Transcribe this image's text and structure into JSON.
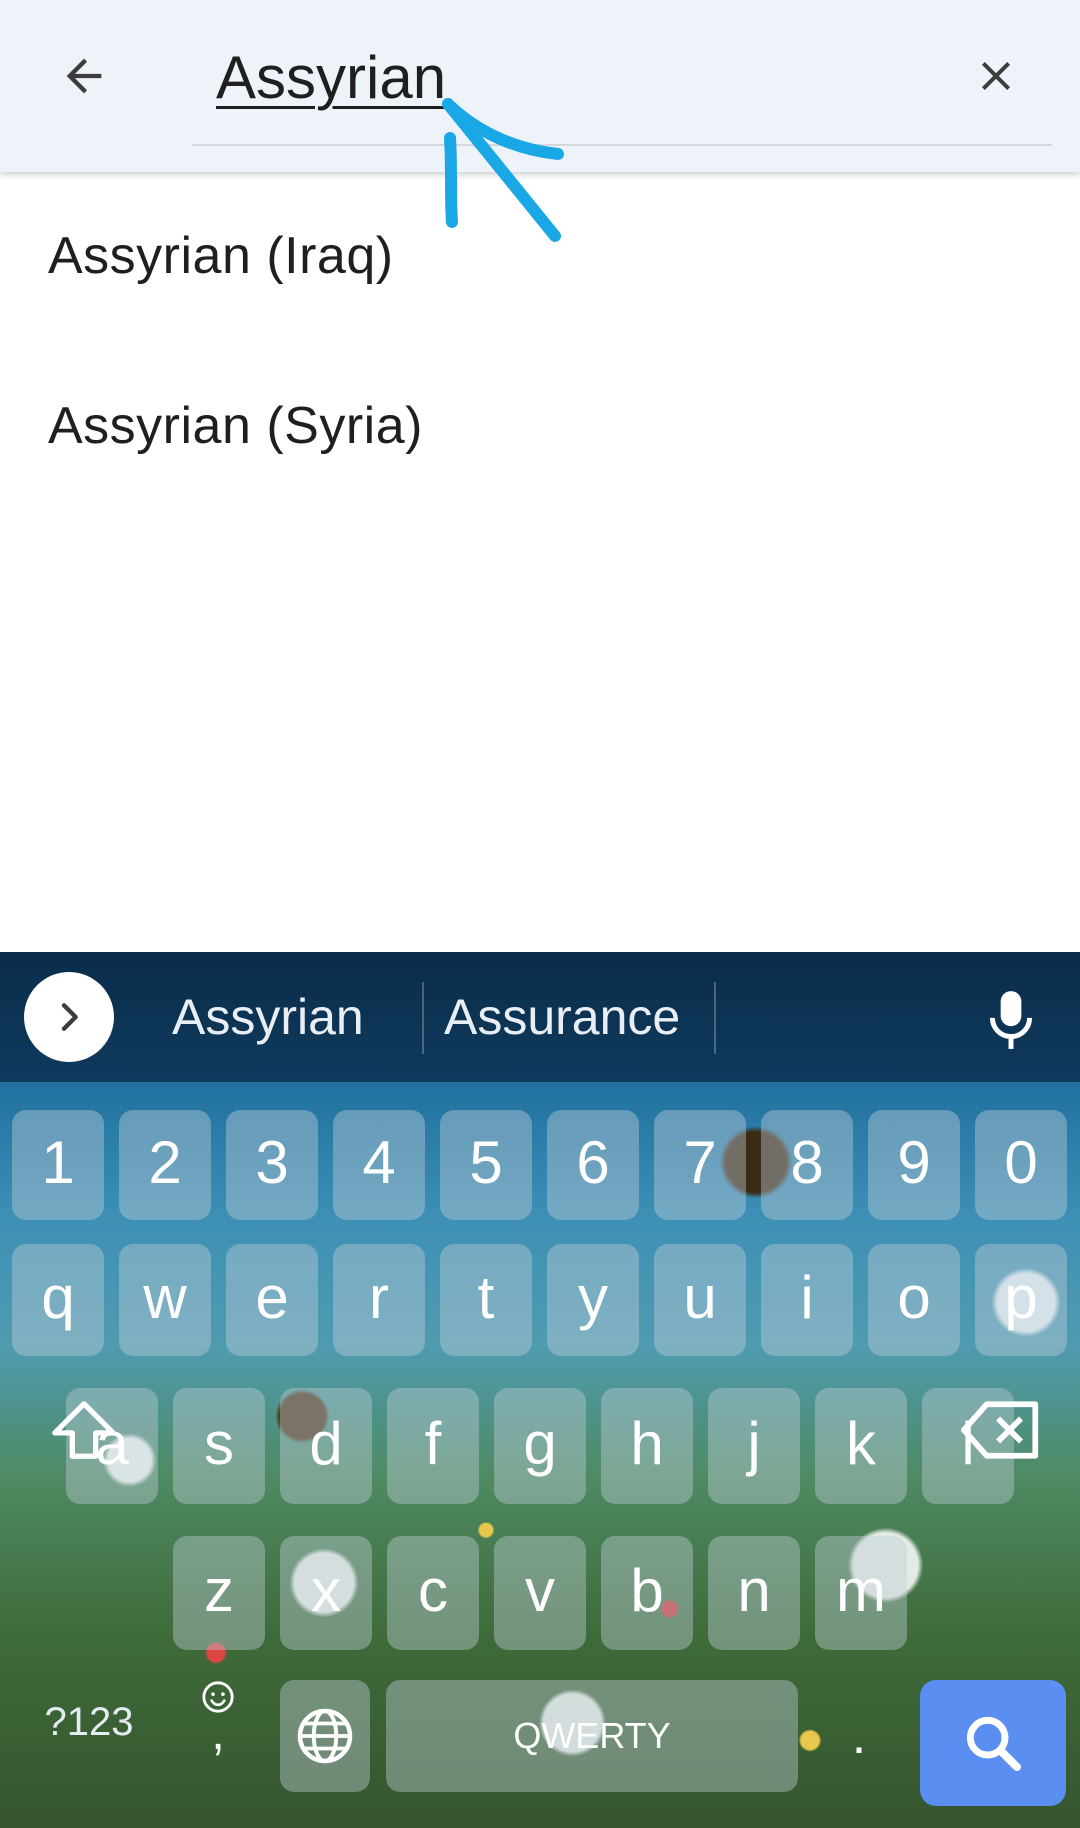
{
  "search": {
    "value": "Assyrian"
  },
  "results": [
    {
      "label": "Assyrian (Iraq)"
    },
    {
      "label": "Assyrian (Syria)"
    }
  ],
  "keyboard": {
    "suggestions": [
      "Assyrian",
      "Assurance"
    ],
    "number_row": [
      "1",
      "2",
      "3",
      "4",
      "5",
      "6",
      "7",
      "8",
      "9",
      "0"
    ],
    "row1": [
      "q",
      "w",
      "e",
      "r",
      "t",
      "y",
      "u",
      "i",
      "o",
      "p"
    ],
    "row2": [
      "a",
      "s",
      "d",
      "f",
      "g",
      "h",
      "j",
      "k",
      "l"
    ],
    "row3": [
      "z",
      "x",
      "c",
      "v",
      "b",
      "n",
      "m"
    ],
    "symbols_label": "?123",
    "comma_label": ",",
    "space_label": "QWERTY",
    "period_label": "."
  },
  "colors": {
    "header_bg": "#eef3fa",
    "annotation": "#1aa7e6",
    "search_key": "#5a8ef0"
  },
  "icons": {
    "back": "arrow-left",
    "clear": "close",
    "expand": "chevron-right",
    "mic": "microphone",
    "shift": "shift-arrow",
    "backspace": "backspace",
    "emoji": "smiley",
    "language": "globe",
    "search": "magnifier"
  }
}
